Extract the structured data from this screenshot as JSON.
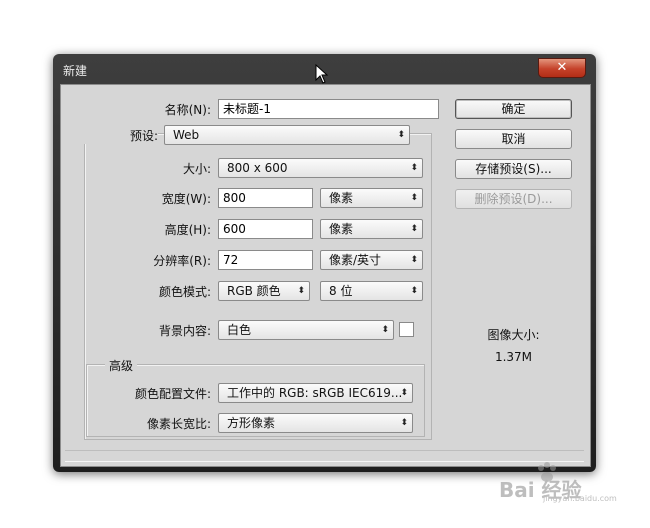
{
  "window": {
    "title": "新建",
    "close_glyph": "✕"
  },
  "form": {
    "name_label": "名称(N):",
    "name_value": "未标题-1",
    "preset_label": "预设:",
    "preset_value": "Web",
    "size_label": "大小:",
    "size_value": "800 x 600",
    "width_label": "宽度(W):",
    "width_value": "800",
    "width_unit": "像素",
    "height_label": "高度(H):",
    "height_value": "600",
    "height_unit": "像素",
    "resolution_label": "分辨率(R):",
    "resolution_value": "72",
    "resolution_unit": "像素/英寸",
    "color_mode_label": "颜色模式:",
    "color_mode_value": "RGB 颜色",
    "bit_depth_value": "8 位",
    "background_label": "背景内容:",
    "background_value": "白色"
  },
  "advanced": {
    "title": "高级",
    "color_profile_label": "颜色配置文件:",
    "color_profile_value": "工作中的 RGB: sRGB IEC619...",
    "pixel_aspect_label": "像素长宽比:",
    "pixel_aspect_value": "方形像素"
  },
  "buttons": {
    "ok": "确定",
    "cancel": "取消",
    "save_preset": "存储预设(S)...",
    "delete_preset": "删除预设(D)..."
  },
  "image_size": {
    "label": "图像大小:",
    "value": "1.37M"
  },
  "icons": {
    "dropdown_arrow": "⬍"
  },
  "watermark": {
    "text": "Bai 经验",
    "sub": "jingyan.baidu.com"
  }
}
